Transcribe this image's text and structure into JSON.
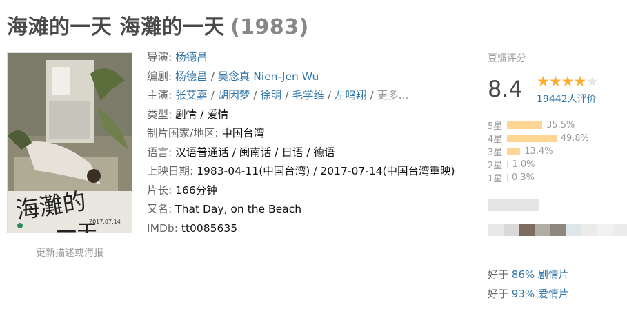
{
  "title": {
    "main": "海滩的一天 海灘的一天",
    "year": "(1983)"
  },
  "poster": {
    "update_link": "更新描述或海报"
  },
  "info": {
    "director_label": "导演:",
    "directors": [
      "杨德昌"
    ],
    "writer_label": "编剧:",
    "writers": [
      "杨德昌",
      "吴念真 Nien-Jen Wu"
    ],
    "cast_label": "主演:",
    "cast": [
      "张艾嘉",
      "胡因梦",
      "徐明",
      "毛学维",
      "左鸣翔"
    ],
    "more": "更多...",
    "genre_label": "类型:",
    "genres": "剧情 / 爱情",
    "country_label": "制片国家/地区:",
    "country": "中国台湾",
    "language_label": "语言:",
    "language": "汉语普通话 / 闽南话 / 日语 / 德语",
    "release_label": "上映日期:",
    "release": "1983-04-11(中国台湾) / 2017-07-14(中国台湾重映)",
    "runtime_label": "片长:",
    "runtime": "166分钟",
    "aka_label": "又名:",
    "aka": "That Day, on the Beach",
    "imdb_label": "IMDb:",
    "imdb": "tt0085635"
  },
  "rating": {
    "title": "豆瓣评分",
    "score": "8.4",
    "stars_filled": 4,
    "stars_total": 5,
    "count": "19442人评价",
    "distribution": [
      {
        "label": "5星",
        "pct_text": "35.5%",
        "pct": 35.5
      },
      {
        "label": "4星",
        "pct_text": "49.8%",
        "pct": 49.8
      },
      {
        "label": "3星",
        "pct_text": "13.4%",
        "pct": 13.4
      },
      {
        "label": "2星",
        "pct_text": "1.0%",
        "pct": 1.0
      },
      {
        "label": "1星",
        "pct_text": "0.3%",
        "pct": 0.3
      }
    ],
    "better_than": [
      {
        "prefix": "好于",
        "link": "86% 剧情片"
      },
      {
        "prefix": "好于",
        "link": "93% 爱情片"
      }
    ]
  },
  "colors": {
    "link": "#3377aa",
    "star": "#ffac2d",
    "bar": "#ffd596"
  }
}
